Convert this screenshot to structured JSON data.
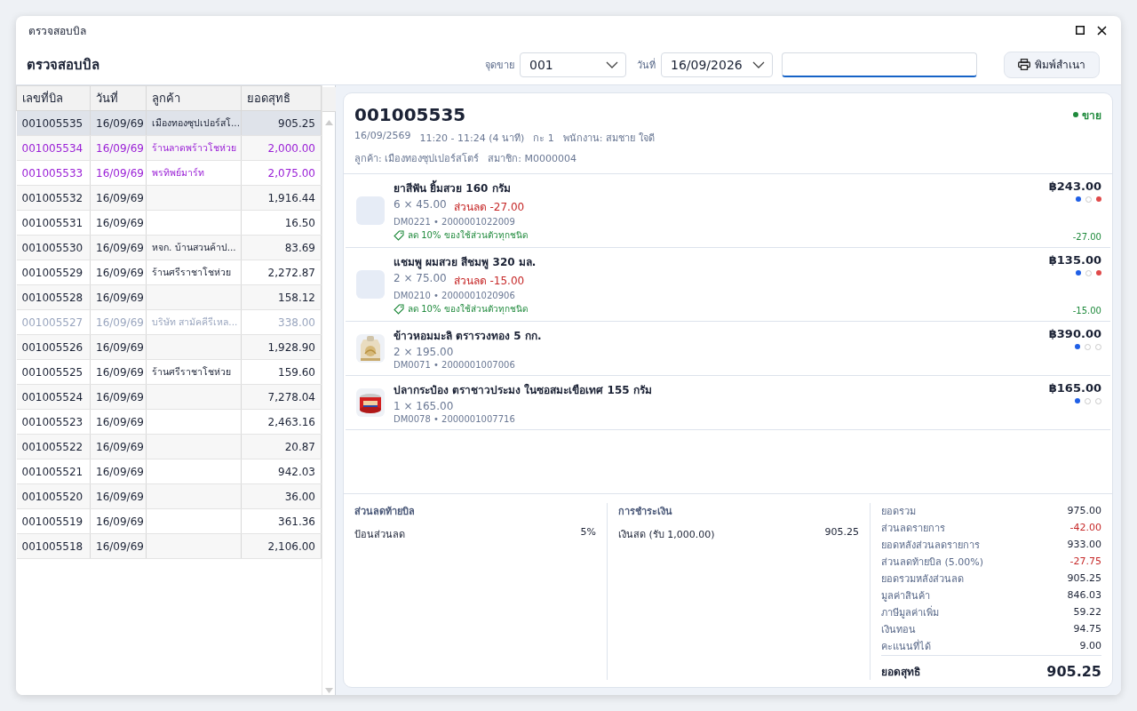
{
  "window": {
    "title": "ตรวจสอบบิล"
  },
  "header": {
    "title": "ตรวจสอบบิล",
    "terminal": {
      "label": "จุดขาย",
      "value": "001"
    },
    "date": {
      "label": "วันที่",
      "value": "16/09/2026"
    },
    "search": {
      "focused": true
    },
    "print_button": "พิมพ์สำเนา"
  },
  "bills": {
    "columns": [
      "เลขที่บิล",
      "วันที่",
      "ลูกค้า",
      "ยอดสุทธิ"
    ],
    "rows": [
      {
        "number": "001005535",
        "date": "16/09/69",
        "customer": "เมืองทองซุปเปอร์สโ...",
        "total": "905.25",
        "selected": true,
        "kind": "normal"
      },
      {
        "number": "001005534",
        "date": "16/09/69",
        "customer": "ร้านลาดพร้าวโชห่วย",
        "total": "2,000.00",
        "selected": false,
        "kind": "credit"
      },
      {
        "number": "001005533",
        "date": "16/09/69",
        "customer": "พรทิพย์มาร์ท",
        "total": "2,075.00",
        "selected": false,
        "kind": "credit"
      },
      {
        "number": "001005532",
        "date": "16/09/69",
        "total": "1,916.44",
        "selected": false,
        "kind": "normal"
      },
      {
        "number": "001005531",
        "date": "16/09/69",
        "total": "16.50",
        "selected": false,
        "kind": "normal"
      },
      {
        "number": "001005530",
        "date": "16/09/69",
        "customer": "หจก. บ้านสวนค้าป...",
        "total": "83.69",
        "selected": false,
        "kind": "normal"
      },
      {
        "number": "001005529",
        "date": "16/09/69",
        "customer": "ร้านศรีราชาโชห่วย",
        "total": "2,272.87",
        "selected": false,
        "kind": "normal"
      },
      {
        "number": "001005528",
        "date": "16/09/69",
        "total": "158.12",
        "selected": false,
        "kind": "normal"
      },
      {
        "number": "001005527",
        "date": "16/09/69",
        "customer": "บริษัท สามัคคีรีเหล...",
        "total": "338.00",
        "selected": false,
        "kind": "void"
      },
      {
        "number": "001005526",
        "date": "16/09/69",
        "total": "1,928.90",
        "selected": false,
        "kind": "normal"
      },
      {
        "number": "001005525",
        "date": "16/09/69",
        "customer": "ร้านศรีราชาโชห่วย",
        "total": "159.60",
        "selected": false,
        "kind": "normal"
      },
      {
        "number": "001005524",
        "date": "16/09/69",
        "total": "7,278.04",
        "selected": false,
        "kind": "normal"
      },
      {
        "number": "001005523",
        "date": "16/09/69",
        "total": "2,463.16",
        "selected": false,
        "kind": "normal"
      },
      {
        "number": "001005522",
        "date": "16/09/69",
        "total": "20.87",
        "selected": false,
        "kind": "normal"
      },
      {
        "number": "001005521",
        "date": "16/09/69",
        "total": "942.03",
        "selected": false,
        "kind": "normal"
      },
      {
        "number": "001005520",
        "date": "16/09/69",
        "total": "36.00",
        "selected": false,
        "kind": "normal"
      },
      {
        "number": "001005519",
        "date": "16/09/69",
        "total": "361.36",
        "selected": false,
        "kind": "normal"
      },
      {
        "number": "001005518",
        "date": "16/09/69",
        "total": "2,106.00",
        "selected": false,
        "kind": "normal"
      }
    ]
  },
  "bill": {
    "number": "001005535",
    "status": "ขาย",
    "meta": [
      "16/09/2569",
      "11:20 - 11:24 (4 นาที)",
      "กะ 1",
      "พนักงาน: สมชาย ใจดี"
    ],
    "meta_2": [
      "ลูกค้า: เมืองทองซุปเปอร์สโตร์",
      "สมาชิก: M0000004"
    ],
    "items": [
      {
        "thumbnail": {
          "kind": "placeholder"
        },
        "name": "ยาสีฟัน ยิ้มสวย 160 กรัม",
        "qty_price": "6 × 45.00",
        "discount": "ส่วนลด -27.00",
        "code": "DM0221 • 2000001022009",
        "promo": "ลด 10% ของใช้ส่วนตัวทุกชนิด",
        "promo_amount": "-27.00",
        "amount": "฿243.00",
        "dots": [
          {
            "filled": true,
            "color": "#1f5fe6"
          },
          {
            "filled": false
          },
          {
            "filled": true,
            "color": "#e04a4a"
          }
        ]
      },
      {
        "thumbnail": {
          "kind": "placeholder"
        },
        "name": "แชมพู ผมสวย สีชมพู 320 มล.",
        "qty_price": "2 × 75.00",
        "discount": "ส่วนลด -15.00",
        "code": "DM0210 • 2000001020906",
        "promo": "ลด 10% ของใช้ส่วนตัวทุกชนิด",
        "promo_amount": "-15.00",
        "amount": "฿135.00",
        "dots": [
          {
            "filled": true,
            "color": "#1f5fe6"
          },
          {
            "filled": false
          },
          {
            "filled": true,
            "color": "#e04a4a"
          }
        ]
      },
      {
        "thumbnail": {
          "kind": "picture"
        },
        "name": "ข้าวหอมมะลิ ตรารวงทอง 5 กก.",
        "qty_price": "2 × 195.00",
        "code": "DM0071 • 2000001007006",
        "amount": "฿390.00",
        "dots": [
          {
            "filled": true,
            "color": "#1f5fe6"
          },
          {
            "filled": false
          },
          {
            "filled": false
          }
        ]
      },
      {
        "thumbnail": {
          "kind": "picture"
        },
        "name": "ปลากระป๋อง ตราชาวประมง ในซอสมะเขือเทศ 155 กรัม",
        "qty_price": "1 × 165.00",
        "code": "DM0078 • 2000001007716",
        "amount": "฿165.00",
        "dots": [
          {
            "filled": true,
            "color": "#1f5fe6"
          },
          {
            "filled": false
          },
          {
            "filled": false
          }
        ]
      }
    ],
    "bill_discount": {
      "title": "ส่วนลดท้ายบิล",
      "rows": [
        {
          "label": "ป้อนส่วนลด",
          "value": "5%"
        }
      ]
    },
    "payment": {
      "title": "การชำระเงิน",
      "rows": [
        {
          "label": "เงินสด (รับ 1,000.00)",
          "value": "905.25"
        }
      ]
    },
    "totals": {
      "rows": [
        {
          "label": "ยอดรวม",
          "value": "975.00",
          "kind": "plain"
        },
        {
          "label": "ส่วนลดรายการ",
          "value": "-42.00",
          "kind": "deduction"
        },
        {
          "label": "ยอดหลังส่วนลดรายการ",
          "value": "933.00",
          "kind": "plain"
        },
        {
          "label": "ส่วนลดท้ายบิล (5.00%)",
          "value": "-27.75",
          "kind": "deduction"
        },
        {
          "label": "ยอดรวมหลังส่วนลด",
          "value": "905.25",
          "kind": "plain"
        },
        {
          "label": "มูลค่าสินค้า",
          "value": "846.03",
          "kind": "plain"
        },
        {
          "label": "ภาษีมูลค่าเพิ่ม",
          "value": "59.22",
          "kind": "plain"
        },
        {
          "label": "เงินทอน",
          "value": "94.75",
          "kind": "plain"
        },
        {
          "label": "คะแนนที่ได้",
          "value": "9.00",
          "kind": "plain"
        }
      ],
      "net": {
        "label": "ยอดสุทธิ",
        "value": "905.25"
      }
    }
  }
}
